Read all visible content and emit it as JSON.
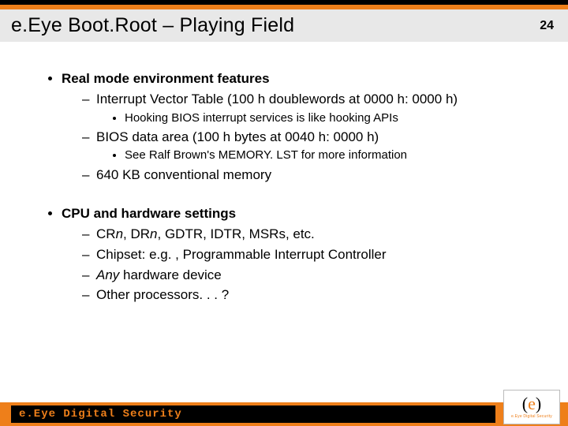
{
  "title": "e.Eye Boot.Root – Playing Field",
  "page_number": "24",
  "bullets": {
    "b1": {
      "head": "Real mode environment features",
      "s1": {
        "text": "Interrupt Vector Table (100 h doublewords at 0000 h: 0000 h)",
        "sub1": "Hooking BIOS interrupt services is like hooking APIs"
      },
      "s2": {
        "text": "BIOS data area (100 h bytes at 0040 h: 0000 h)",
        "sub1": "See Ralf Brown's MEMORY. LST for more information"
      },
      "s3": {
        "text": "640 KB conventional memory"
      }
    },
    "b2": {
      "head": "CPU and hardware settings",
      "s1": {
        "pre": "CR",
        "ital1": "n",
        "mid": ", DR",
        "ital2": "n",
        "post": ", GDTR, IDTR, MSRs, etc."
      },
      "s2": {
        "text": "Chipset: e.g. , Programmable Interrupt Controller"
      },
      "s3": {
        "ital": "Any",
        "post": " hardware device"
      },
      "s4": {
        "text": "Other processors. . . ?"
      }
    }
  },
  "footer": {
    "brand": "e.Eye Digital Security",
    "logo_sub": "e.Eye Digital Security"
  }
}
